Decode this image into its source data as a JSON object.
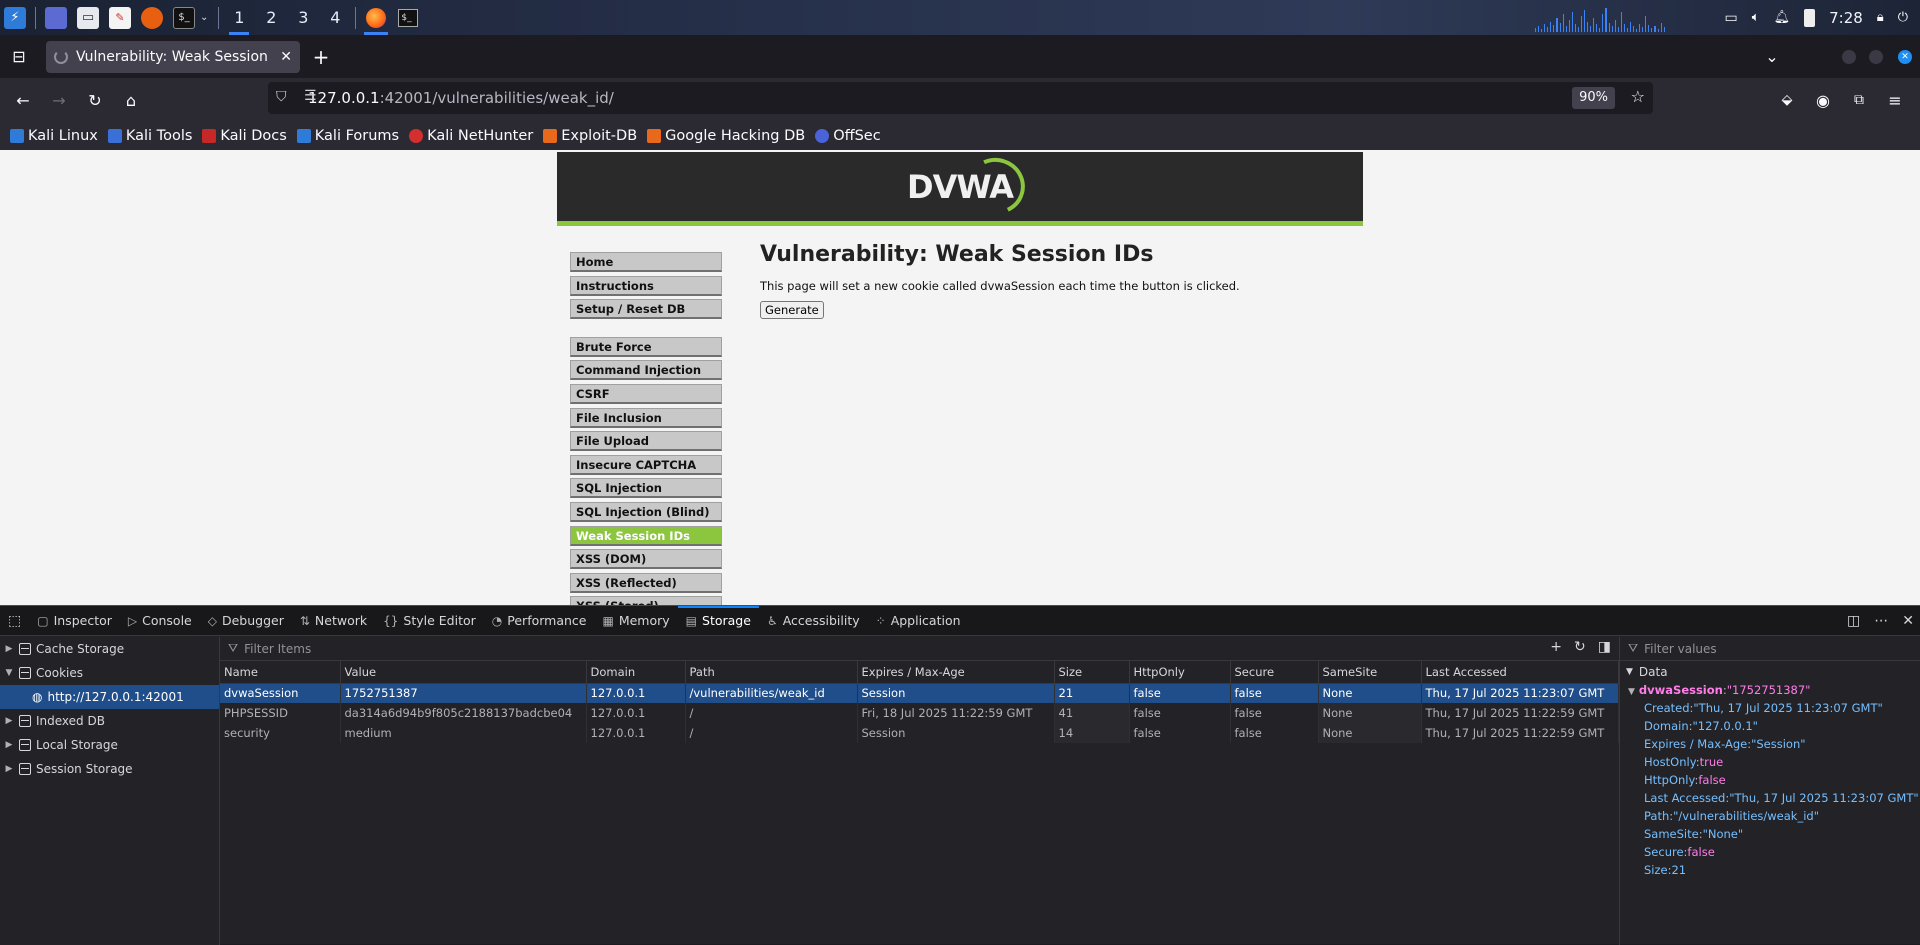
{
  "panel": {
    "workspaces": [
      "1",
      "2",
      "3",
      "4"
    ],
    "clock": "7:28"
  },
  "browser": {
    "tab_title": "Vulnerability: Weak Session IDs :: Damn Vulnerable Web Application (DVWA)",
    "url_host": "127.0.0.1",
    "url_rest": ":42001/vulnerabilities/weak_id/",
    "zoom": "90%",
    "bookmarks": [
      "Kali Linux",
      "Kali Tools",
      "Kali Docs",
      "Kali Forums",
      "Kali NetHunter",
      "Exploit-DB",
      "Google Hacking DB",
      "OffSec"
    ]
  },
  "dvwa": {
    "logo": "DVWA",
    "menu_top": [
      "Home",
      "Instructions",
      "Setup / Reset DB"
    ],
    "menu_vulns": [
      "Brute Force",
      "Command Injection",
      "CSRF",
      "File Inclusion",
      "File Upload",
      "Insecure CAPTCHA",
      "SQL Injection",
      "SQL Injection (Blind)",
      "Weak Session IDs",
      "XSS (DOM)",
      "XSS (Reflected)",
      "XSS (Stored)"
    ],
    "selected": "Weak Session IDs",
    "heading": "Vulnerability: Weak Session IDs",
    "description": "This page will set a new cookie called dvwaSession each time the button is clicked.",
    "button": "Generate"
  },
  "devtools": {
    "tabs": [
      "Inspector",
      "Console",
      "Debugger",
      "Network",
      "Style Editor",
      "Performance",
      "Memory",
      "Storage",
      "Accessibility",
      "Application"
    ],
    "active_tab": "Storage",
    "tree": {
      "cache_storage": "Cache Storage",
      "cookies": "Cookies",
      "cookie_host": "http://127.0.0.1:42001",
      "indexed_db": "Indexed DB",
      "local_storage": "Local Storage",
      "session_storage": "Session Storage"
    },
    "filter_placeholder": "Filter Items",
    "columns": [
      "Name",
      "Value",
      "Domain",
      "Path",
      "Expires / Max-Age",
      "Size",
      "HttpOnly",
      "Secure",
      "SameSite",
      "Last Accessed"
    ],
    "rows": [
      [
        "dvwaSession",
        "1752751387",
        "127.0.0.1",
        "/vulnerabilities/weak_id",
        "Session",
        "21",
        "false",
        "false",
        "None",
        "Thu, 17 Jul 2025 11:23:07 GMT"
      ],
      [
        "PHPSESSID",
        "da314a6d94b9f805c2188137badcbe04",
        "127.0.0.1",
        "/",
        "Fri, 18 Jul 2025 11:22:59 GMT",
        "41",
        "false",
        "false",
        "None",
        "Thu, 17 Jul 2025 11:22:59 GMT"
      ],
      [
        "security",
        "medium",
        "127.0.0.1",
        "/",
        "Session",
        "14",
        "false",
        "false",
        "None",
        "Thu, 17 Jul 2025 11:22:59 GMT"
      ]
    ],
    "sidebar": {
      "filter_placeholder": "Filter values",
      "section": "Data",
      "root_key": "dvwaSession",
      "root_val": "\"1752751387\"",
      "props": [
        {
          "k": "Created",
          "v": "\"Thu, 17 Jul 2025 11:23:07 GMT\"",
          "t": "str"
        },
        {
          "k": "Domain",
          "v": "\"127.0.0.1\"",
          "t": "str"
        },
        {
          "k": "Expires / Max-Age",
          "v": "\"Session\"",
          "t": "str"
        },
        {
          "k": "HostOnly",
          "v": "true",
          "t": "bool"
        },
        {
          "k": "HttpOnly",
          "v": "false",
          "t": "bool"
        },
        {
          "k": "Last Accessed",
          "v": "\"Thu, 17 Jul 2025 11:23:07 GMT\"",
          "t": "str"
        },
        {
          "k": "Path",
          "v": "\"/vulnerabilities/weak_id\"",
          "t": "str"
        },
        {
          "k": "SameSite",
          "v": "\"None\"",
          "t": "str"
        },
        {
          "k": "Secure",
          "v": "false",
          "t": "bool"
        },
        {
          "k": "Size",
          "v": "21",
          "t": "num"
        }
      ]
    }
  }
}
